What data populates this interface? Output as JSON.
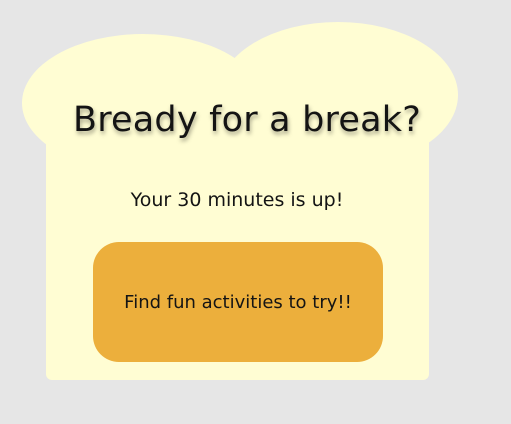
{
  "dialog": {
    "headline": "Bready for a break?",
    "message": "Your 30 minutes is up!",
    "cta_label": "Find fun activities to try!!"
  },
  "colors": {
    "background": "#e6e6e6",
    "toast": "#fffdd3",
    "button": "#ecaf3c",
    "text": "#141414"
  }
}
